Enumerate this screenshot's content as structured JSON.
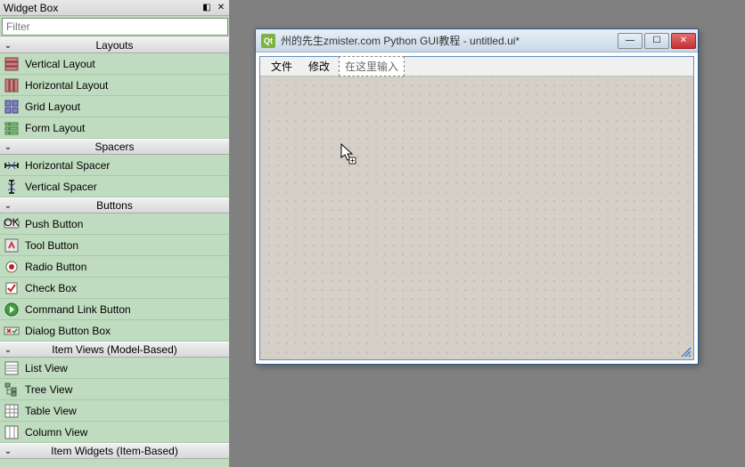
{
  "widgetbox": {
    "title": "Widget Box",
    "filter_placeholder": "Filter",
    "sections": [
      {
        "title": "Layouts",
        "items": [
          {
            "label": "Vertical Layout",
            "icon": "vlayout"
          },
          {
            "label": "Horizontal Layout",
            "icon": "hlayout"
          },
          {
            "label": "Grid Layout",
            "icon": "grid"
          },
          {
            "label": "Form Layout",
            "icon": "form"
          }
        ]
      },
      {
        "title": "Spacers",
        "items": [
          {
            "label": "Horizontal Spacer",
            "icon": "hspacer"
          },
          {
            "label": "Vertical Spacer",
            "icon": "vspacer"
          }
        ]
      },
      {
        "title": "Buttons",
        "items": [
          {
            "label": "Push Button",
            "icon": "pushbtn"
          },
          {
            "label": "Tool Button",
            "icon": "toolbtn"
          },
          {
            "label": "Radio Button",
            "icon": "radio"
          },
          {
            "label": "Check Box",
            "icon": "check"
          },
          {
            "label": "Command Link Button",
            "icon": "cmdlink"
          },
          {
            "label": "Dialog Button Box",
            "icon": "dlgbtn"
          }
        ]
      },
      {
        "title": "Item Views (Model-Based)",
        "items": [
          {
            "label": "List View",
            "icon": "listview"
          },
          {
            "label": "Tree View",
            "icon": "treeview"
          },
          {
            "label": "Table View",
            "icon": "tableview"
          },
          {
            "label": "Column View",
            "icon": "columnview"
          }
        ]
      },
      {
        "title": "Item Widgets (Item-Based)",
        "items": []
      }
    ]
  },
  "designer_window": {
    "title": "州的先生zmister.com Python GUI教程 - untitled.ui*",
    "menubar": [
      "文件",
      "修改"
    ],
    "menubar_placeholder": "在这里输入"
  }
}
